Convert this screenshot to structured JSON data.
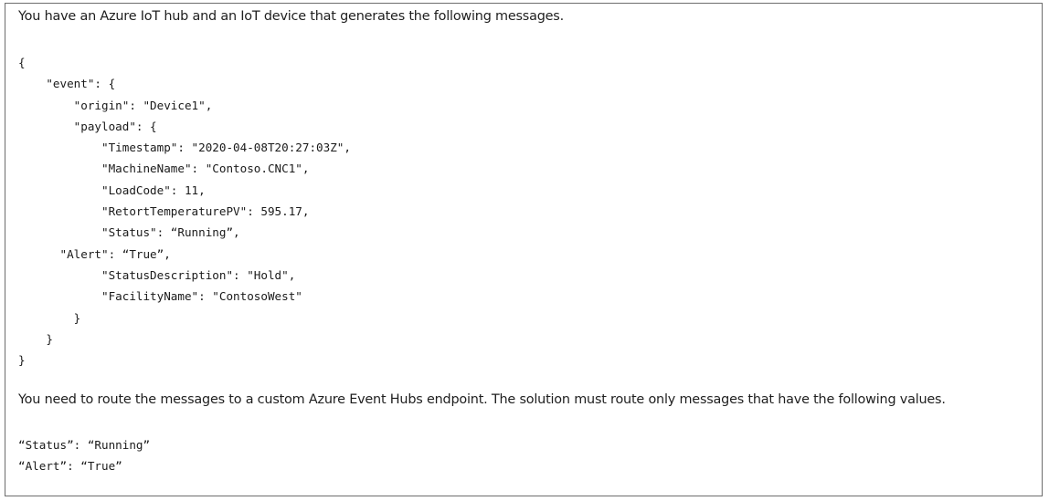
{
  "intro_text": "You have an Azure IoT hub and an IoT device that generates the following messages.",
  "message_json": "{\n    \"event\": {\n        \"origin\": \"Device1\",\n        \"payload\": {\n            \"Timestamp\": \"2020-04-08T20:27:03Z\",\n            \"MachineName\": \"Contoso.CNC1\",\n            \"LoadCode\": 11,\n            \"RetortTemperaturePV\": 595.17,\n            \"Status\": “Running”,\n      \"Alert\": “True”,\n            \"StatusDescription\": \"Hold\",\n            \"FacilityName\": \"ContosoWest\"\n        }\n    }\n}",
  "route_text": "You need to route the messages to a custom Azure Event Hubs endpoint. The solution must route only messages that have the following values.",
  "route_conditions": "“Status”: “Running”\n“Alert”: “True”"
}
